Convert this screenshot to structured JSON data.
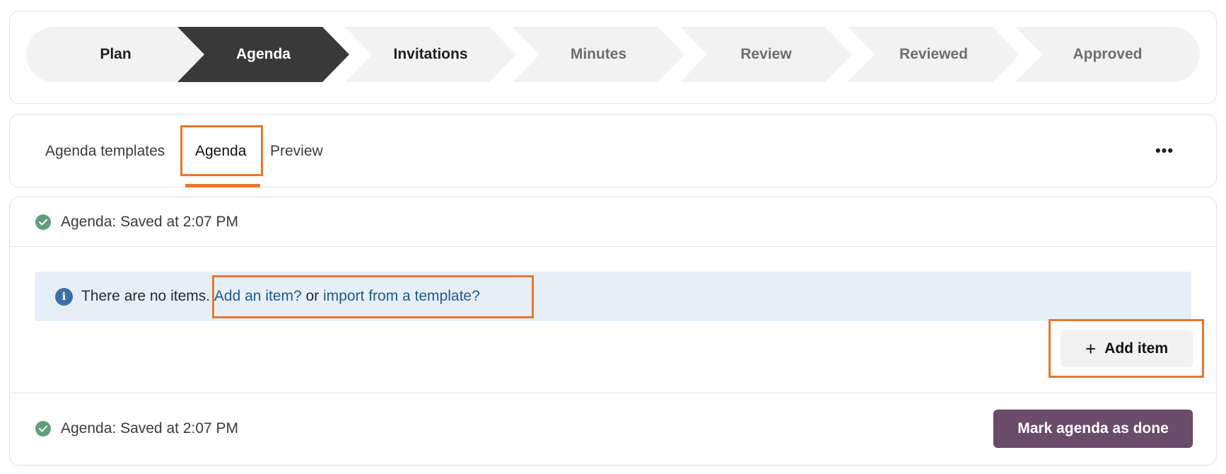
{
  "stepper": {
    "steps": [
      {
        "label": "Plan",
        "state": "done"
      },
      {
        "label": "Agenda",
        "state": "active"
      },
      {
        "label": "Invitations",
        "state": "done"
      },
      {
        "label": "Minutes",
        "state": "pending"
      },
      {
        "label": "Review",
        "state": "pending"
      },
      {
        "label": "Reviewed",
        "state": "pending"
      },
      {
        "label": "Approved",
        "state": "pending"
      }
    ]
  },
  "tabs": {
    "items": [
      {
        "label": "Agenda templates"
      },
      {
        "label": "Agenda"
      },
      {
        "label": "Preview"
      }
    ],
    "active": "Agenda",
    "more_icon": "more-horizontal-icon",
    "more_label": "•••"
  },
  "main": {
    "top_status": "Agenda: Saved at 2:07 PM",
    "bottom_status": "Agenda: Saved at 2:07 PM",
    "info": {
      "prefix": "There are no items. ",
      "add_link": "Add an item?",
      "middle": " or ",
      "import_link": "import from a template?"
    },
    "add_item_label": "Add item",
    "add_item_icon": "plus-icon",
    "done_label": "Mark agenda as done"
  },
  "colors": {
    "accent_highlight": "#e8762d",
    "active_step": "#393939",
    "primary_button": "#6a4c6a",
    "success": "#5f9f7a",
    "info_bg": "#e6eff7",
    "link": "#1e5a8c"
  }
}
